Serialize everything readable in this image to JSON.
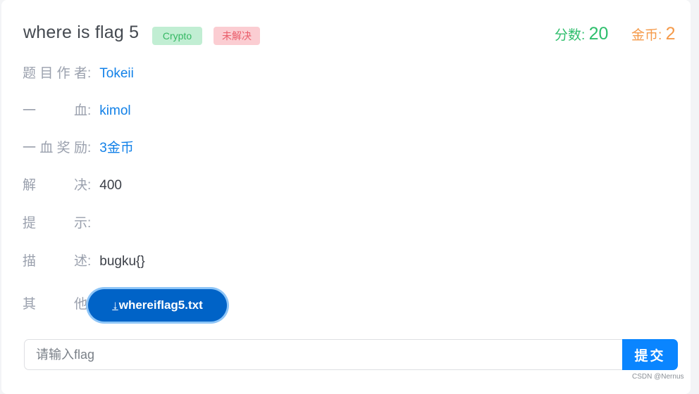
{
  "challenge": {
    "title": "where is flag 5",
    "category": "Crypto",
    "status": "未解决",
    "score_label": "分数:",
    "score_value": "20",
    "coins_label": "金币:",
    "coins_value": "2"
  },
  "details": [
    {
      "label": "题目作者",
      "value": "Tokeii",
      "style": "link"
    },
    {
      "label": "一血",
      "value": "kimol",
      "style": "link"
    },
    {
      "label": "一血奖励",
      "value": "3金币",
      "style": "link"
    },
    {
      "label": "解决",
      "value": "400",
      "style": "plain"
    },
    {
      "label": "提示",
      "value": "",
      "style": "plain"
    },
    {
      "label": "描述",
      "value": "bugku{}",
      "style": "plain"
    },
    {
      "label": "其他",
      "value": "",
      "style": "plain"
    }
  ],
  "attachment": {
    "icon": "download-arrow-icon",
    "icon_glyph": "↓",
    "filename": "whereiflag5.txt"
  },
  "submit_form": {
    "placeholder": "请输入flag",
    "value": "",
    "submit_label": "提交"
  },
  "watermark": "CSDN @Nernus",
  "colors": {
    "link": "#1281e8",
    "score": "#2ebe6c",
    "coins": "#f59a4a",
    "primary_button": "#0a85ff",
    "download_button": "#0063c7"
  }
}
